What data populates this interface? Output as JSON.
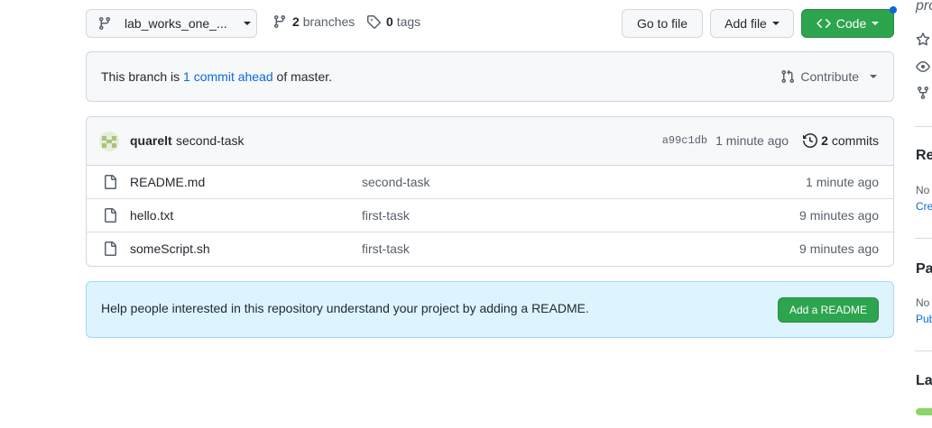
{
  "toolbar": {
    "branch_name": "lab_works_one_...",
    "branches_count": "2",
    "branches_label": "branches",
    "tags_count": "0",
    "tags_label": "tags",
    "goto_label": "Go to file",
    "addfile_label": "Add file",
    "code_label": "Code"
  },
  "branch_info": {
    "prefix": "This branch is ",
    "link": "1 commit ahead",
    "suffix": " of master.",
    "contribute_label": "Contribute"
  },
  "latest_commit": {
    "author": "quarelt",
    "message": "second-task",
    "sha": "a99c1db",
    "age": "1 minute ago",
    "commits_count": "2",
    "commits_label": "commits"
  },
  "files": [
    {
      "name": "README.md",
      "message": "second-task",
      "age": "1 minute ago"
    },
    {
      "name": "hello.txt",
      "message": "first-task",
      "age": "9 minutes ago"
    },
    {
      "name": "someScript.sh",
      "message": "first-task",
      "age": "9 minutes ago"
    }
  ],
  "readme_prompt": {
    "text": "Help people interested in this repository understand your project by adding a README.",
    "button_label": "Add a README"
  },
  "sidebar": {
    "top_text": "pro",
    "heading_1": "Re",
    "text_1": "No",
    "link_1": "Cre",
    "heading_2": "Pa",
    "text_2": "No",
    "link_2": "Pub",
    "heading_3": "La"
  },
  "colors": {
    "primary_green": "#2da44e",
    "link_blue": "#0969da",
    "info_bg": "#ddf4ff"
  }
}
